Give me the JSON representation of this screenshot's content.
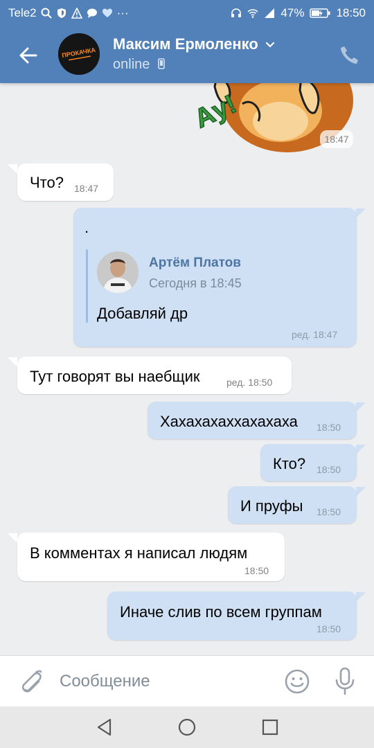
{
  "status_bar": {
    "carrier": "Tele2",
    "battery": "47%",
    "time": "18:50",
    "icons": [
      "search-icon",
      "shield-icon",
      "warning-icon",
      "chat-icon",
      "heart-icon",
      "more-icon",
      "headset-icon",
      "wifi-icon",
      "signal-icon",
      "battery-icon"
    ]
  },
  "header": {
    "contact_name": "Максим Ермоленко",
    "status": "online",
    "avatar_text": "ПРОКАЧКА",
    "colors": {
      "bar": "#5181b8"
    }
  },
  "sticker": {
    "text": "Ау!",
    "time": "18:47"
  },
  "messages": [
    {
      "dir": "in",
      "text": "Что?",
      "time": "18:47"
    },
    {
      "dir": "out",
      "text": ".",
      "time": "ред. 18:47",
      "forwarded": {
        "author": "Артём Платов",
        "date": "Сегодня в 18:45",
        "text": "Добавляй др"
      }
    },
    {
      "dir": "in",
      "text": "Тут говорят вы наебщик",
      "time": "ред. 18:50"
    },
    {
      "dir": "out",
      "text": "Хахахахаххахахаха",
      "time": "18:50"
    },
    {
      "dir": "out",
      "text": "Кто?",
      "time": "18:50"
    },
    {
      "dir": "out",
      "text": "И пруфы",
      "time": "18:50"
    },
    {
      "dir": "in",
      "text": "В комментах я написал людям",
      "time": "18:50"
    },
    {
      "dir": "out",
      "text": "Иначе слив по всем группам",
      "time": "18:50"
    }
  ],
  "composer": {
    "placeholder": "Сообщение"
  },
  "colors": {
    "incoming": "#ffffff",
    "outgoing": "#cfe0f4",
    "background": "#edeef0",
    "accent": "#5181b8"
  }
}
